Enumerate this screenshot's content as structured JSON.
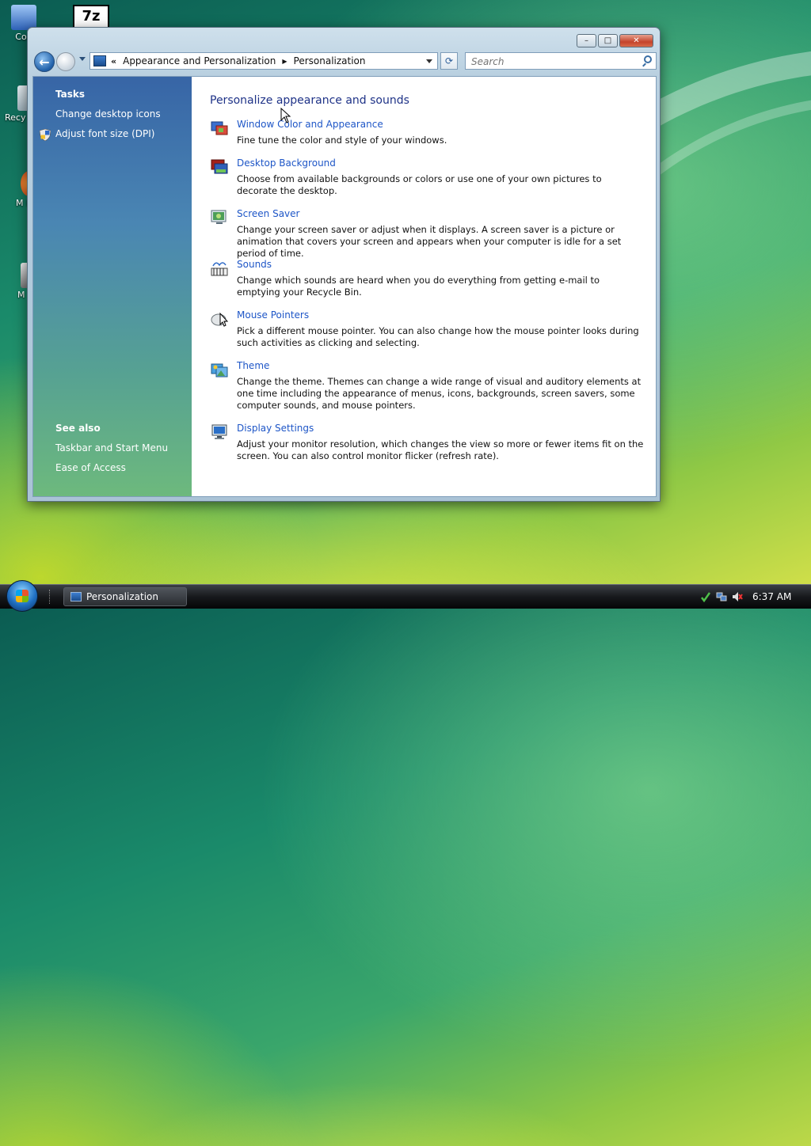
{
  "desktop": {
    "icons": [
      {
        "label": "Con"
      },
      {
        "label": "Recy"
      },
      {
        "label": "M Fi"
      },
      {
        "label": "M"
      }
    ],
    "sevenzip_label": "7z"
  },
  "window": {
    "title": "Personalization",
    "caption": {
      "minimize": "–",
      "maximize": "□",
      "close": "✕"
    },
    "nav": {
      "back_glyph": "←",
      "address_chevron": "«",
      "breadcrumb": [
        "Appearance and Personalization",
        "Personalization"
      ],
      "separator": "▶",
      "refresh_glyph": "⟳",
      "search_placeholder": "Search"
    },
    "sidebar": {
      "tasks_heading": "Tasks",
      "tasks": [
        "Change desktop icons",
        "Adjust font size (DPI)"
      ],
      "see_also_heading": "See also",
      "see_also": [
        "Taskbar and Start Menu",
        "Ease of Access"
      ]
    },
    "main": {
      "title": "Personalize appearance and sounds",
      "items": [
        {
          "link": "Window Color and Appearance",
          "desc": "Fine tune the color and style of your windows.",
          "icon": "window-color-icon"
        },
        {
          "link": "Desktop Background",
          "desc": "Choose from available backgrounds or colors or use one of your own pictures to decorate the desktop.",
          "icon": "desktop-background-icon"
        },
        {
          "link": "Screen Saver",
          "desc": "Change your screen saver or adjust when it displays. A screen saver is a picture or animation that covers your screen and appears when your computer is idle for a set period of time.",
          "icon": "screen-saver-icon"
        },
        {
          "link": "Sounds",
          "desc": "Change which sounds are heard when you do everything from getting e-mail to emptying your Recycle Bin.",
          "icon": "sounds-icon"
        },
        {
          "link": "Mouse Pointers",
          "desc": "Pick a different mouse pointer. You can also change how the mouse pointer looks during such activities as clicking and selecting.",
          "icon": "mouse-pointer-icon"
        },
        {
          "link": "Theme",
          "desc": "Change the theme. Themes can change a wide range of visual and auditory elements at one time including the appearance of menus, icons, backgrounds, screen savers, some computer sounds, and mouse pointers.",
          "icon": "theme-icon"
        },
        {
          "link": "Display Settings",
          "desc": "Adjust your monitor resolution, which changes the view so more or fewer items fit on the screen. You can also control monitor flicker (refresh rate).",
          "icon": "display-settings-icon"
        }
      ]
    }
  },
  "taskbar": {
    "task_label": "Personalization",
    "clock": "6:37 AM"
  },
  "colors": {
    "link": "#1e56c7",
    "title": "#1e3287",
    "sidebar_top": "#3765a6",
    "sidebar_bottom": "#6db97d"
  }
}
